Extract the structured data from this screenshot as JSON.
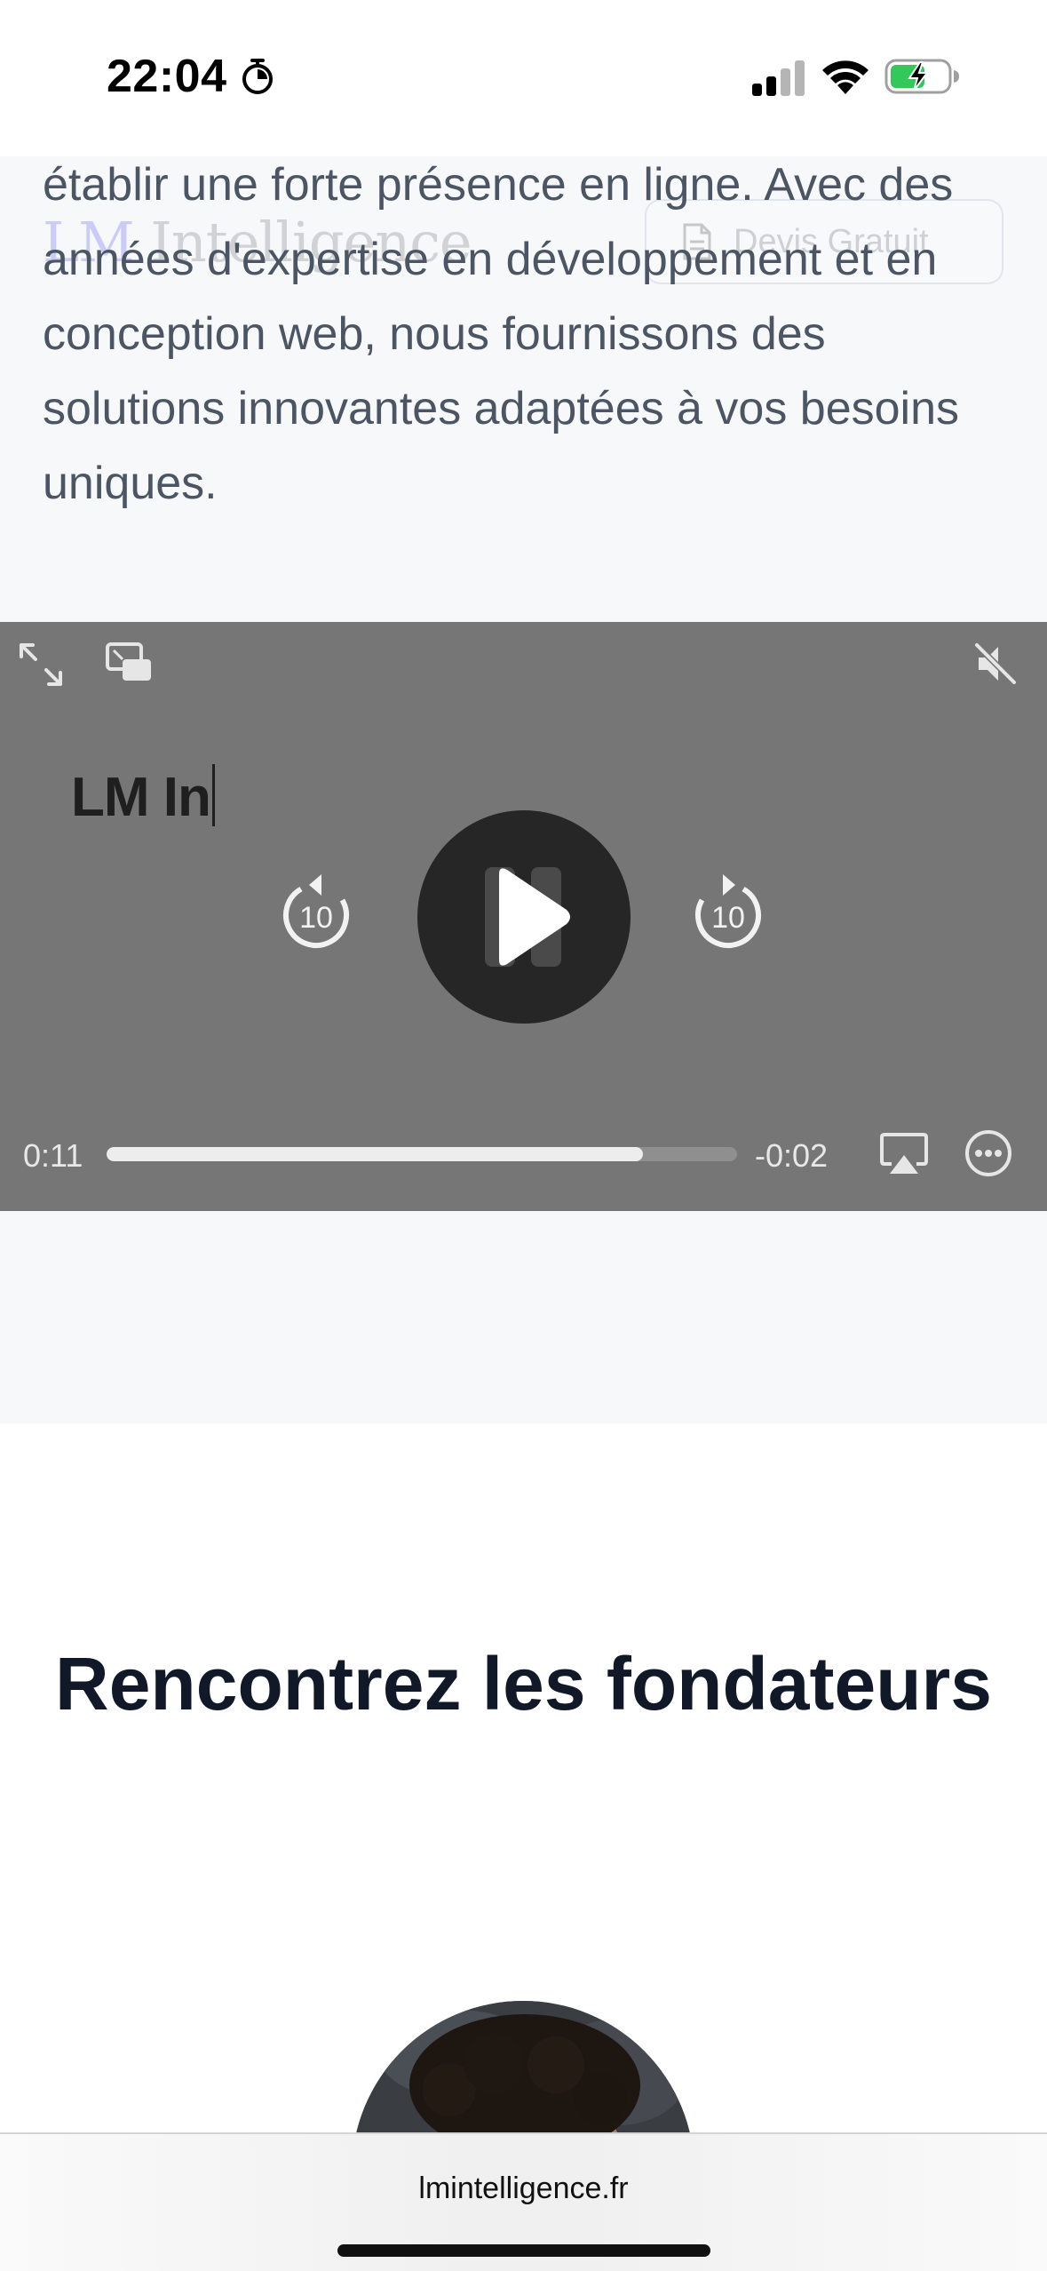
{
  "status_bar": {
    "time": "22:04",
    "icons": [
      "timer-icon",
      "cellular-signal-icon",
      "wifi-icon",
      "battery-charging-icon"
    ],
    "battery_color": "#34c759"
  },
  "site_header": {
    "logo_prefix": "LM",
    "logo_rest": " Intelligence",
    "quote_button_label": "Devis Gratuit"
  },
  "hero": {
    "text": "établir une forte présence en ligne. Avec des années d'expertise en développement et en conception web, nous fournissons des solutions innovantes adaptées à vos besoins uniques."
  },
  "video_player": {
    "caption": "LM In",
    "elapsed": "0:11",
    "remaining": "-0:02",
    "skip_seconds": "10",
    "progress_percent": 85,
    "state": "paused"
  },
  "founders": {
    "heading": "Rencontrez les fondateurs"
  },
  "browser": {
    "url": "lmintelligence.fr"
  },
  "colors": {
    "page_background": "#f7f8fa",
    "video_background": "#767676",
    "heading": "#111827",
    "body_text": "#4b5563",
    "logo_accent": "#6366f1"
  }
}
